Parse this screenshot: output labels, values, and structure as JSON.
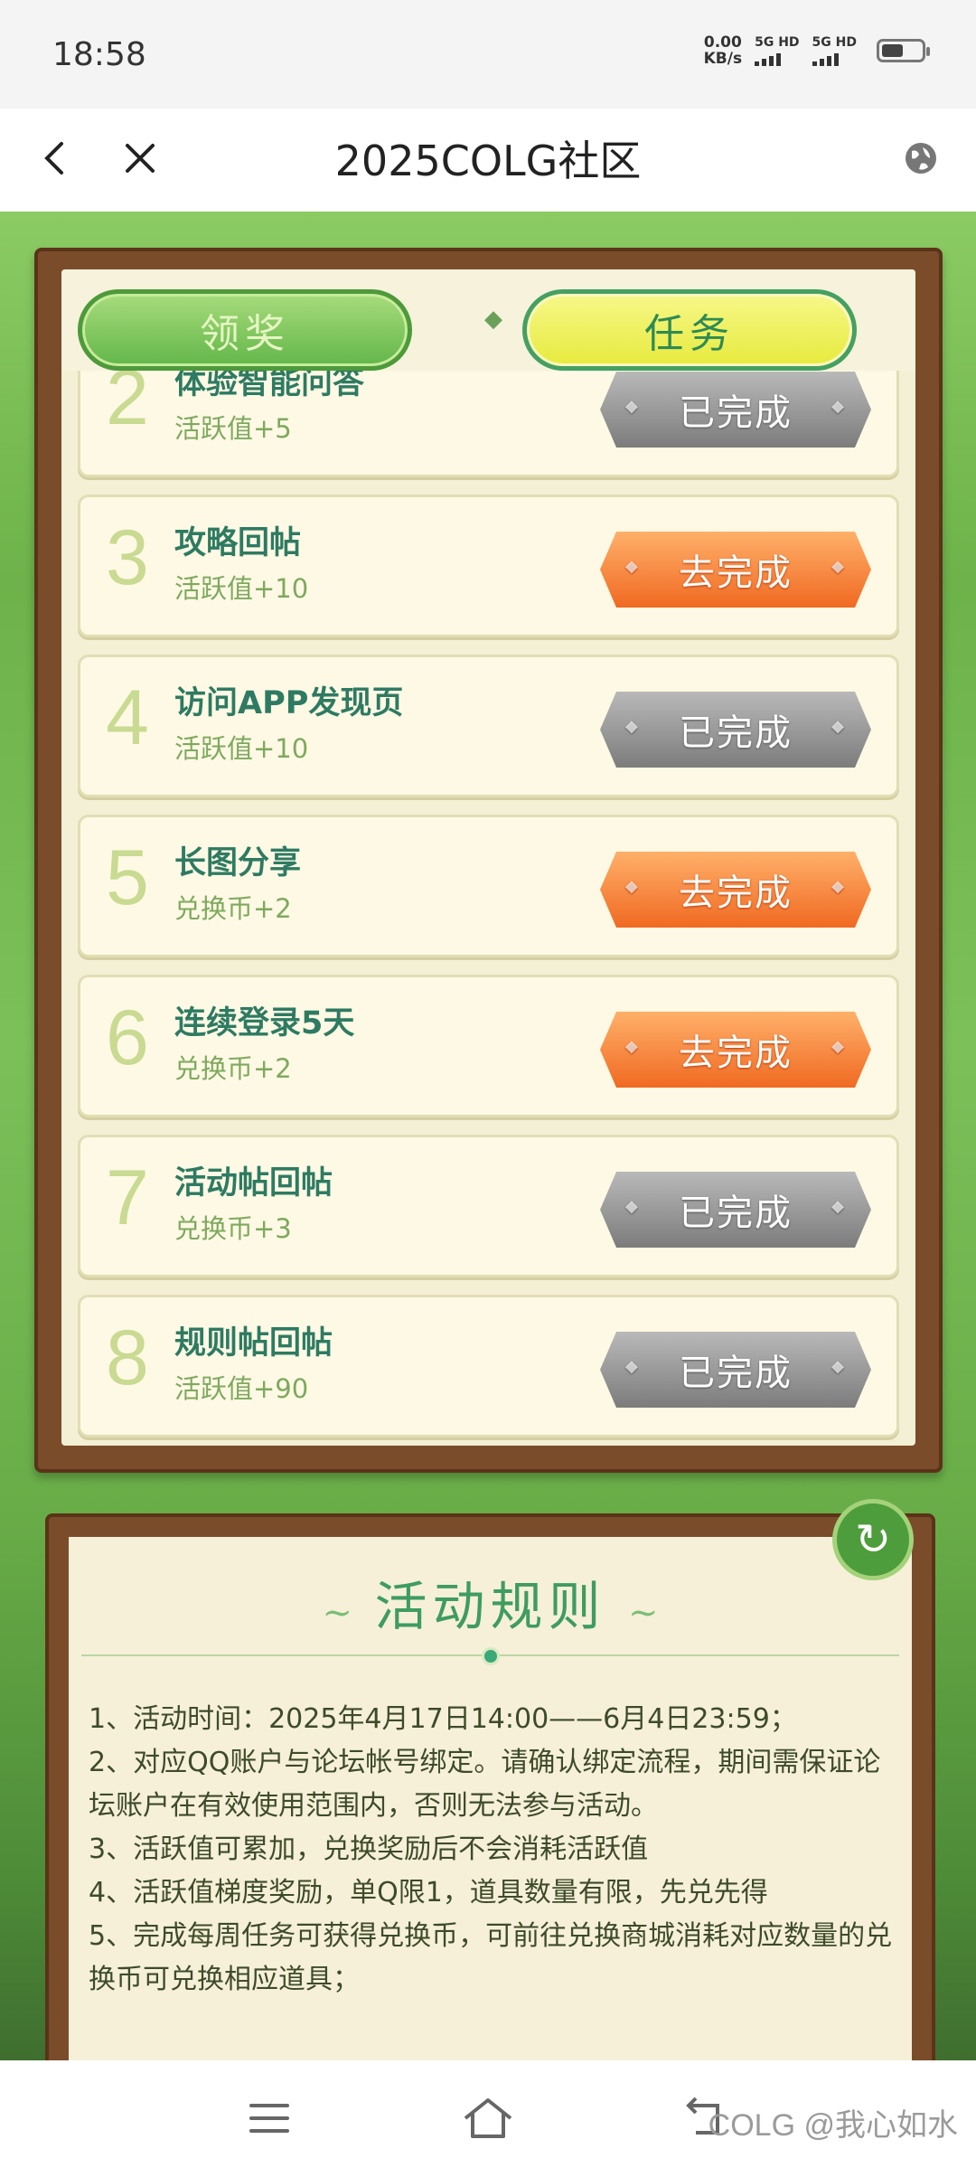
{
  "status_bar": {
    "time": "18:58",
    "net_speed_value": "0.00",
    "net_speed_unit": "KB/s",
    "sim1": "5G HD",
    "sim2": "5G HD",
    "battery_level": 0.55
  },
  "nav": {
    "title": "2025COLG社区"
  },
  "tabs": {
    "claim_label": "领奖",
    "tasks_label": "任务"
  },
  "tasks": [
    {
      "num": "2",
      "title": "体验智能问答",
      "reward": "活跃值+5",
      "status": "已完成",
      "done": true
    },
    {
      "num": "3",
      "title": "攻略回帖",
      "reward": "活跃值+10",
      "status": "去完成",
      "done": false
    },
    {
      "num": "4",
      "title": "访问APP发现页",
      "reward": "活跃值+10",
      "status": "已完成",
      "done": true
    },
    {
      "num": "5",
      "title": "长图分享",
      "reward": "兑换币+2",
      "status": "去完成",
      "done": false
    },
    {
      "num": "6",
      "title": "连续登录5天",
      "reward": "兑换币+2",
      "status": "去完成",
      "done": false
    },
    {
      "num": "7",
      "title": "活动帖回帖",
      "reward": "兑换币+3",
      "status": "已完成",
      "done": true
    },
    {
      "num": "8",
      "title": "规则帖回帖",
      "reward": "活跃值+90",
      "status": "已完成",
      "done": true
    }
  ],
  "rules": {
    "title": "活动规则",
    "items": [
      "1、活动时间：2025年4月17日14:00——6月4日23:59；",
      "2、对应QQ账户与论坛帐号绑定。请确认绑定流程，期间需保证论坛账户在有效使用范围内，否则无法参与活动。",
      "3、活跃值可累加，兑换奖励后不会消耗活跃值",
      "4、活跃值梯度奖励，单Q限1，道具数量有限，先兑先得",
      "5、完成每周任务可获得兑换币，可前往兑换商城消耗对应数量的兑换币可兑换相应道具；"
    ]
  },
  "watermark": "COLG @我心如水",
  "colors": {
    "accent_green": "#2e7a62",
    "todo_orange": "#f06a22",
    "done_gray": "#8a8a8a",
    "board_brown": "#7a4c2a"
  }
}
